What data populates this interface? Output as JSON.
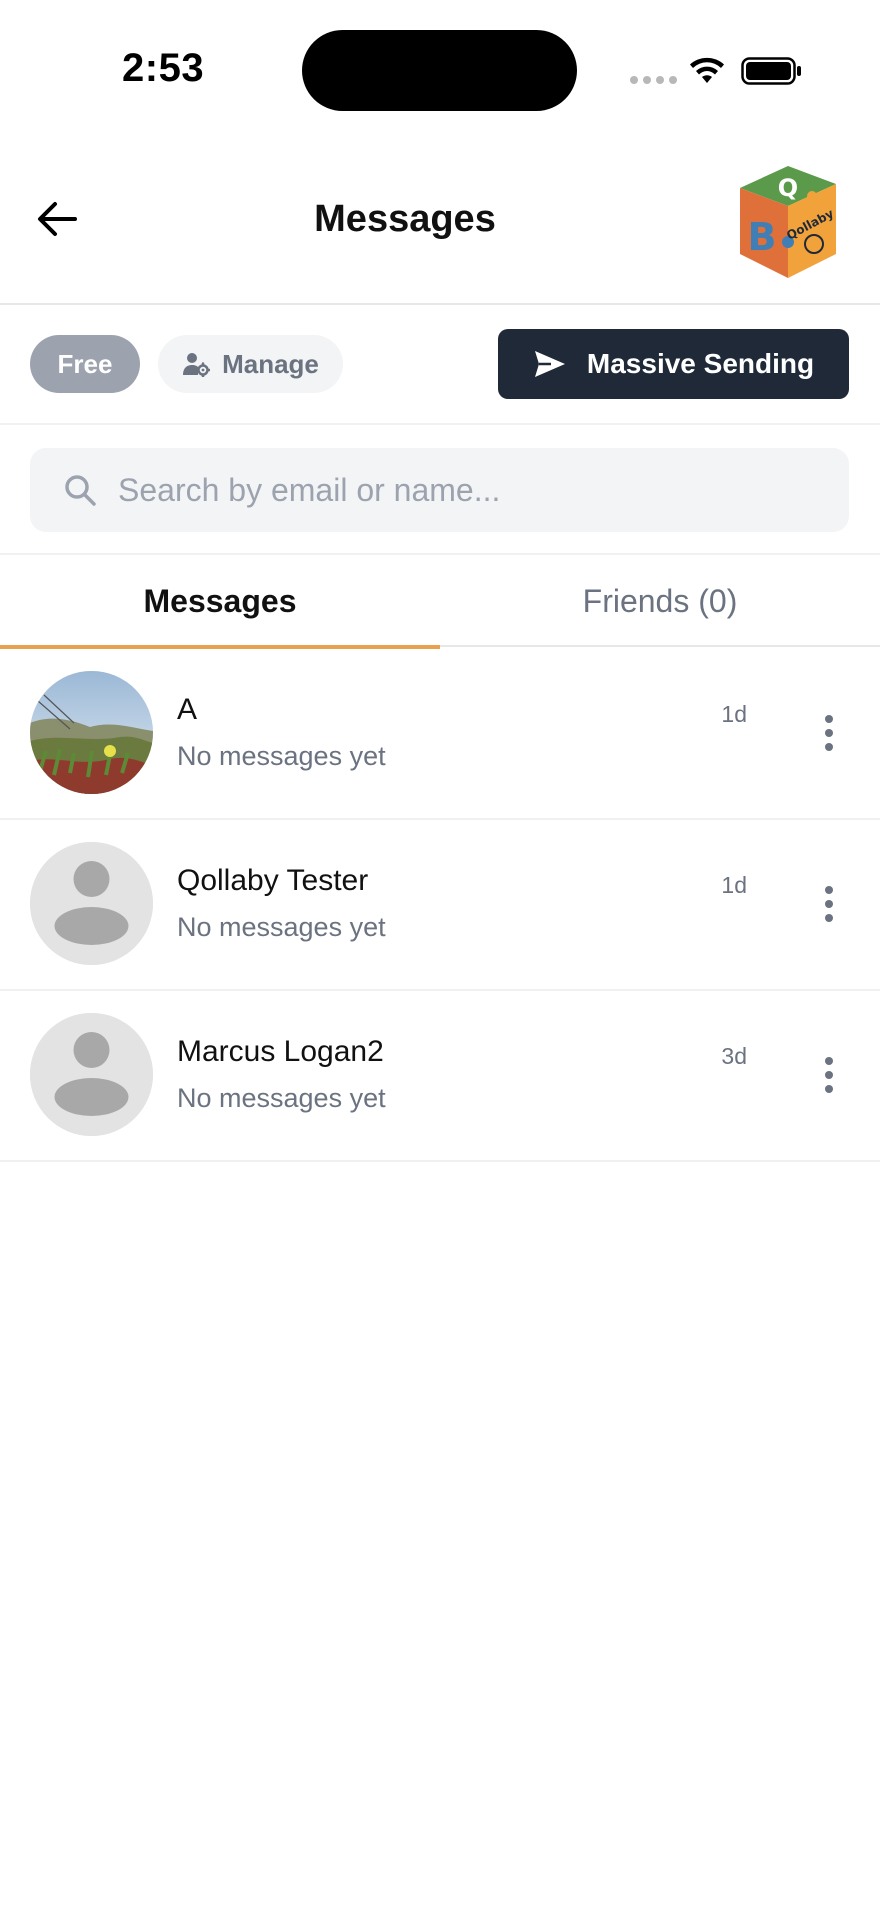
{
  "status_bar": {
    "time": "2:53"
  },
  "header": {
    "title": "Messages",
    "logo_text": "Qollaby",
    "logo_letters": [
      "Q",
      "B"
    ]
  },
  "toolbar": {
    "plan_badge": "Free",
    "manage_label": "Manage",
    "massive_sending_label": "Massive Sending"
  },
  "search": {
    "placeholder": "Search by email or name...",
    "value": ""
  },
  "tabs": [
    {
      "label": "Messages",
      "active": true
    },
    {
      "label": "Friends (0)",
      "active": false
    }
  ],
  "conversations": [
    {
      "name": "A",
      "preview": "No messages yet",
      "time": "1d",
      "avatar": "photo"
    },
    {
      "name": "Qollaby Tester",
      "preview": "No messages yet",
      "time": "1d",
      "avatar": "default-avatar-icon"
    },
    {
      "name": "Marcus Logan2",
      "preview": "No messages yet",
      "time": "3d",
      "avatar": "default-avatar-icon"
    }
  ],
  "colors": {
    "accent_tab_indicator": "#e8a24d",
    "primary_button": "#1f2937",
    "badge_bg": "#9ca3af"
  }
}
